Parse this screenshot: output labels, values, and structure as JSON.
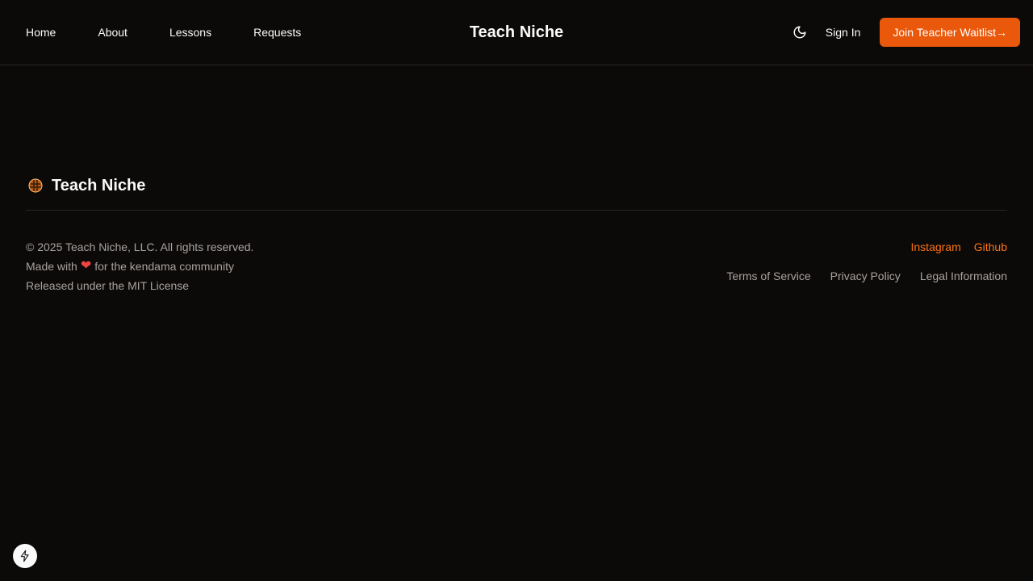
{
  "header": {
    "nav": [
      {
        "label": "Home"
      },
      {
        "label": "About"
      },
      {
        "label": "Lessons"
      },
      {
        "label": "Requests"
      }
    ],
    "brand": "Teach Niche",
    "theme_icon": "moon-icon",
    "sign_in_label": "Sign In",
    "waitlist_label": "Join Teacher Waitlist",
    "waitlist_arrow": "→",
    "accent_color": "#ea580c"
  },
  "footer": {
    "brand": "Teach Niche",
    "logo_icon": "kendama-logo-icon",
    "copyright": "© 2025 Teach Niche, LLC. All rights reserved.",
    "made_with_prefix": "Made with",
    "heart": "❤",
    "made_with_suffix": "for the kendama community",
    "license": "Released under the MIT License",
    "social": [
      {
        "label": "Instagram"
      },
      {
        "label": "Github"
      }
    ],
    "legal": [
      {
        "label": "Terms of Service"
      },
      {
        "label": "Privacy Policy"
      },
      {
        "label": "Legal Information"
      }
    ]
  },
  "dev_badge_icon": "lightning-icon"
}
